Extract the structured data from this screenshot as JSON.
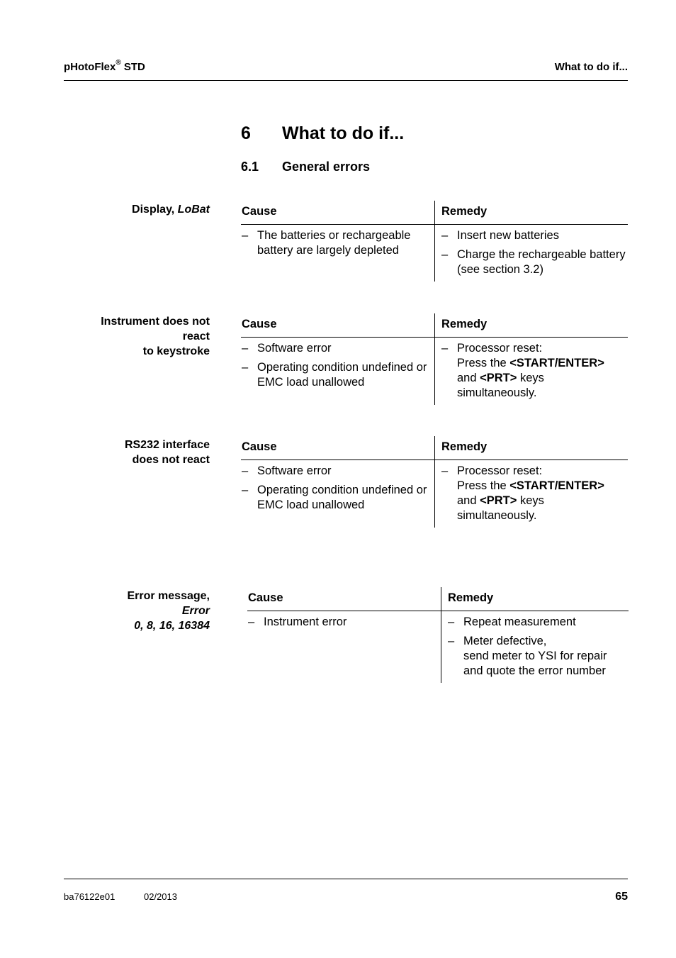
{
  "header": {
    "product": "pHotoFlex",
    "registered_mark": "®",
    "product_suffix": "STD",
    "section_title": "What to do if..."
  },
  "chapter": {
    "number": "6",
    "title": "What to do if..."
  },
  "section": {
    "number": "6.1",
    "title": "General errors"
  },
  "table_headers": {
    "cause": "Cause",
    "remedy": "Remedy"
  },
  "blocks": [
    {
      "label_lines": [
        [
          {
            "t": "Display, ",
            "s": "b"
          },
          {
            "t": "LoBat",
            "s": "bi"
          }
        ]
      ],
      "causes": [
        "The batteries or rechargeable battery are largely depleted"
      ],
      "remedies": [
        [
          {
            "t": "Insert new batteries"
          }
        ],
        [
          {
            "t": "Charge the rechargeable battery (see section 3.2)"
          }
        ]
      ]
    },
    {
      "label_lines": [
        [
          {
            "t": "Instrument does not",
            "s": "b"
          }
        ],
        [
          {
            "t": "react",
            "s": "b"
          }
        ],
        [
          {
            "t": "to keystroke",
            "s": "b"
          }
        ]
      ],
      "causes": [
        "Software error",
        "Operating condition undefined or EMC load unallowed"
      ],
      "remedies": [
        [
          {
            "t": "Processor reset:"
          },
          {
            "br": true
          },
          {
            "t": "Press the "
          },
          {
            "t": "<START/ENTER>",
            "s": "b"
          },
          {
            "br": true
          },
          {
            "t": "and "
          },
          {
            "t": "<PRT>",
            "s": "b"
          },
          {
            "t": " keys"
          },
          {
            "br": true
          },
          {
            "t": "simultaneously."
          }
        ]
      ]
    },
    {
      "label_lines": [
        [
          {
            "t": "RS232 interface",
            "s": "b"
          }
        ],
        [
          {
            "t": "does not react",
            "s": "b"
          }
        ]
      ],
      "causes": [
        "Software error",
        "Operating condition undefined or EMC load unallowed"
      ],
      "remedies": [
        [
          {
            "t": "Processor reset:"
          },
          {
            "br": true
          },
          {
            "t": "Press the "
          },
          {
            "t": "<START/ENTER>",
            "s": "b"
          },
          {
            "br": true
          },
          {
            "t": "and "
          },
          {
            "t": "<PRT>",
            "s": "b"
          },
          {
            "t": " keys"
          },
          {
            "br": true
          },
          {
            "t": "simultaneously."
          }
        ]
      ]
    },
    {
      "label_lines": [
        [
          {
            "t": "Error message,",
            "s": "b"
          }
        ],
        [
          {
            "t": "Error",
            "s": "bi"
          }
        ],
        [
          {
            "t": "0, 8, 16, 16384",
            "s": "bi"
          }
        ]
      ],
      "causes": [
        "Instrument error"
      ],
      "remedies": [
        [
          {
            "t": "Repeat measurement"
          }
        ],
        [
          {
            "t": "Meter defective,"
          },
          {
            "br": true
          },
          {
            "t": "send meter to YSI for repair"
          },
          {
            "br": true
          },
          {
            "t": "and quote the error number"
          }
        ]
      ]
    }
  ],
  "footer": {
    "doc_id": "ba76122e01",
    "date": "02/2013",
    "page_number": "65"
  },
  "dash": "–"
}
